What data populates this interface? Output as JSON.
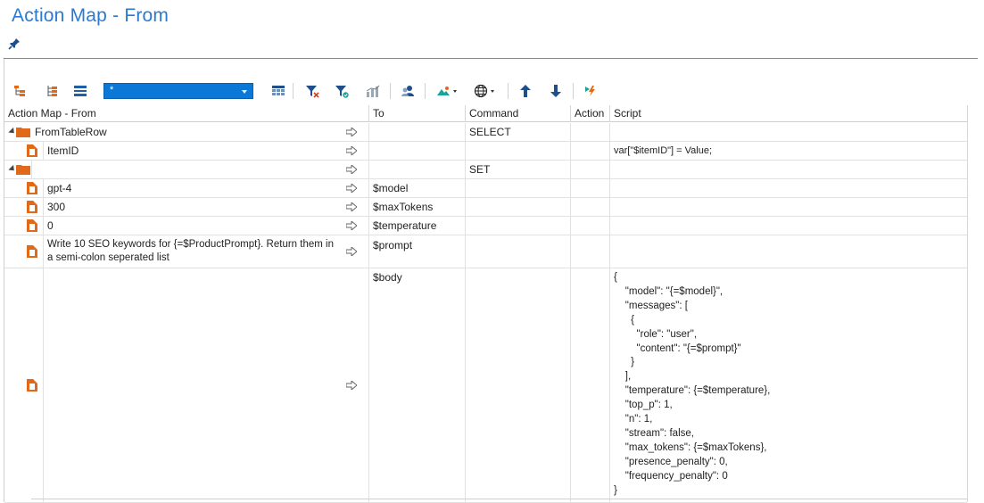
{
  "window": {
    "title": "Action Map - From"
  },
  "toolbar": {
    "combo_value": "*",
    "icons": [
      "tree-expand-icon",
      "tree-collapse-icon",
      "list-icon",
      "table-view-icon",
      "filter-clear-icon",
      "filter-apply-icon",
      "chart-icon",
      "users-icon",
      "image-dropdown-icon",
      "globe-dropdown-icon",
      "move-up-icon",
      "move-down-icon",
      "run-icon"
    ],
    "colors": {
      "combo_bg": "#0b78d7",
      "icon_blue": "#1f5fa8",
      "icon_orange": "#e06a1a",
      "title_blue": "#2a7ad2"
    }
  },
  "columns": {
    "from": "Action Map - From",
    "to": "To",
    "command": "Command",
    "action": "Action",
    "script": "Script"
  },
  "rows": [
    {
      "from": "FromTableRow",
      "to": "",
      "command": "SELECT",
      "action": "",
      "script": ""
    },
    {
      "from": "ItemID",
      "to": "",
      "command": "",
      "action": "",
      "script": "var[\"$itemID\"] =  Value;"
    },
    {
      "from": "",
      "to": "",
      "command": "SET",
      "action": "",
      "script": ""
    },
    {
      "from": "gpt-4",
      "to": "$model",
      "command": "",
      "action": "",
      "script": ""
    },
    {
      "from": "300",
      "to": "$maxTokens",
      "command": "",
      "action": "",
      "script": ""
    },
    {
      "from": "0",
      "to": "$temperature",
      "command": "",
      "action": "",
      "script": ""
    },
    {
      "from_line1": "Write 10 SEO keywords for {=$ProductPrompt}. Return them in",
      "from_line2": "a semi-colon seperated list",
      "to": "$prompt",
      "command": "",
      "action": "",
      "script": ""
    },
    {
      "from": "",
      "to": "$body",
      "command": "",
      "action": "",
      "script": "{\n    \"model\": \"{=$model}\",\n    \"messages\": [\n      {\n        \"role\": \"user\",\n        \"content\": \"{=$prompt}\"\n      }\n    ],\n    \"temperature\": {=$temperature},\n    \"top_p\": 1,\n    \"n\": 1,\n    \"stream\": false,\n    \"max_tokens\": {=$maxTokens},\n    \"presence_penalty\": 0,\n    \"frequency_penalty\": 0\n}"
    }
  ]
}
